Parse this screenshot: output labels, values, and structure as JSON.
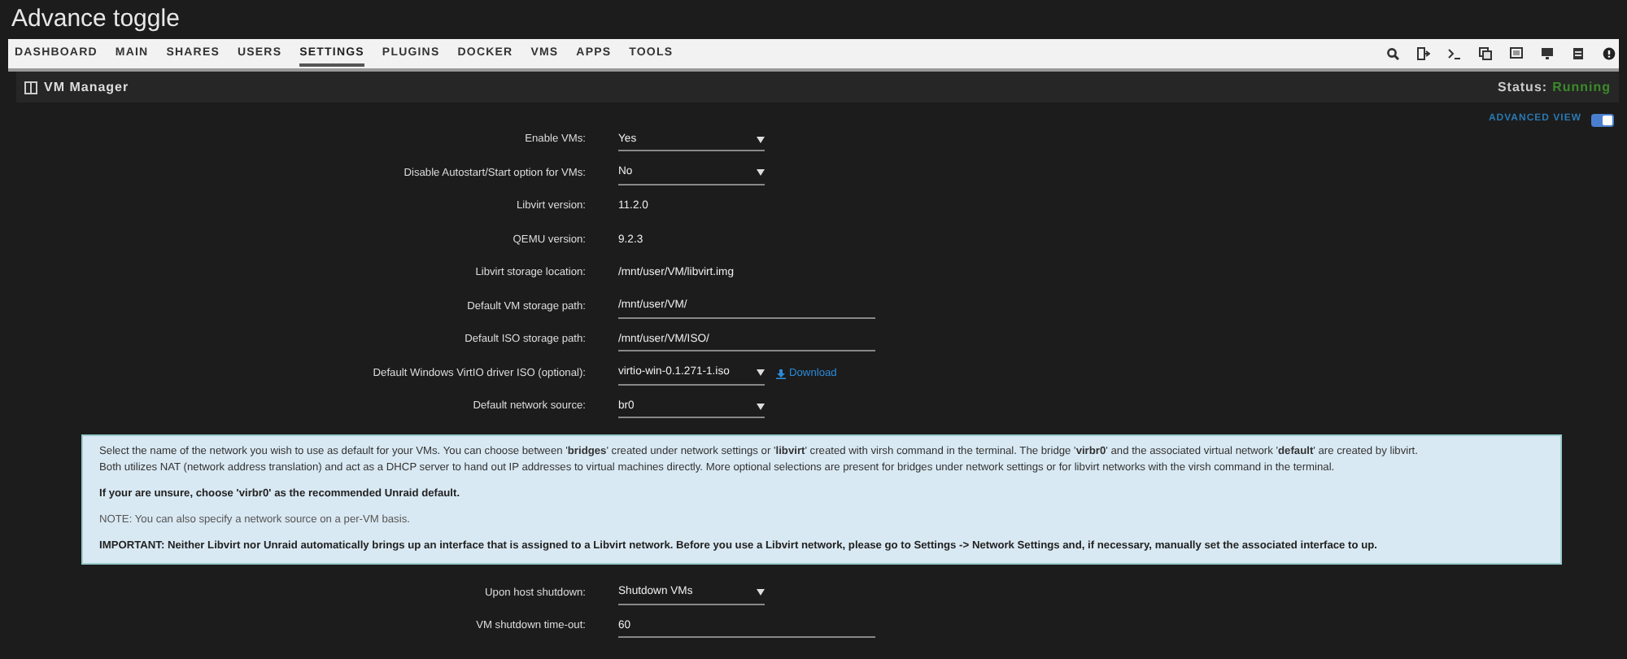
{
  "caption": "Advance toggle",
  "nav": {
    "tabs": [
      {
        "label": "DASHBOARD",
        "selected": false
      },
      {
        "label": "MAIN",
        "selected": false
      },
      {
        "label": "SHARES",
        "selected": false
      },
      {
        "label": "USERS",
        "selected": false
      },
      {
        "label": "SETTINGS",
        "selected": true
      },
      {
        "label": "PLUGINS",
        "selected": false
      },
      {
        "label": "DOCKER",
        "selected": false
      },
      {
        "label": "VMS",
        "selected": false
      },
      {
        "label": "APPS",
        "selected": false
      },
      {
        "label": "TOOLS",
        "selected": false
      }
    ]
  },
  "header": {
    "title": "VM Manager",
    "status_label": "Status:",
    "status_value": "Running"
  },
  "advanced_view": {
    "label": "ADVANCED VIEW",
    "on": true
  },
  "settings": [
    {
      "label": "Enable VMs:",
      "kind": "select",
      "value": "Yes"
    },
    {
      "label": "Disable Autostart/Start option for VMs:",
      "kind": "select",
      "value": "No"
    },
    {
      "label": "Libvirt version:",
      "kind": "text",
      "value": "11.2.0"
    },
    {
      "label": "QEMU version:",
      "kind": "text",
      "value": "9.2.3"
    },
    {
      "label": "Libvirt storage location:",
      "kind": "text",
      "value": "/mnt/user/VM/libvirt.img"
    },
    {
      "label": "Default VM storage path:",
      "kind": "input",
      "value": "/mnt/user/VM/"
    },
    {
      "label": "Default ISO storage path:",
      "kind": "input",
      "value": "/mnt/user/VM/ISO/"
    },
    {
      "label": "Default Windows VirtIO driver ISO (optional):",
      "kind": "select",
      "value": "virtio-win-0.1.271-1.iso",
      "link": "Download"
    },
    {
      "label": "Default network source:",
      "kind": "select",
      "value": "br0"
    }
  ],
  "info": [
    {
      "kind": "normal",
      "lines": [
        "Select the name of the network you wish to use as default for your VMs. You can choose between '**bridges**' created under network settings or '**libvirt**' created with virsh command in the terminal. The bridge '**virbr0**' and the associated virtual network '**default**' are created by libvirt.",
        "Both utilizes NAT (network address translation) and act as a DHCP server to hand out IP addresses to virtual machines directly. More optional selections are present for bridges under network settings or for libvirt networks with the virsh command in the terminal."
      ]
    },
    {
      "kind": "bold",
      "lines": [
        "If your are unsure, choose 'virbr0' as the recommended Unraid default."
      ]
    },
    {
      "kind": "note",
      "lines": [
        "NOTE: You can also specify a network source on a per-VM basis."
      ]
    },
    {
      "kind": "bold",
      "lines": [
        "IMPORTANT: Neither Libvirt nor Unraid automatically brings up an interface that is assigned to a Libvirt network. Before you use a Libvirt network, please go to Settings -> Network Settings and, if necessary, manually set the associated interface to up."
      ]
    }
  ],
  "settings_after": [
    {
      "label": "Upon host shutdown:",
      "kind": "select",
      "value": "Shutdown VMs"
    },
    {
      "label": "VM shutdown time-out:",
      "kind": "input",
      "value": "60"
    }
  ]
}
